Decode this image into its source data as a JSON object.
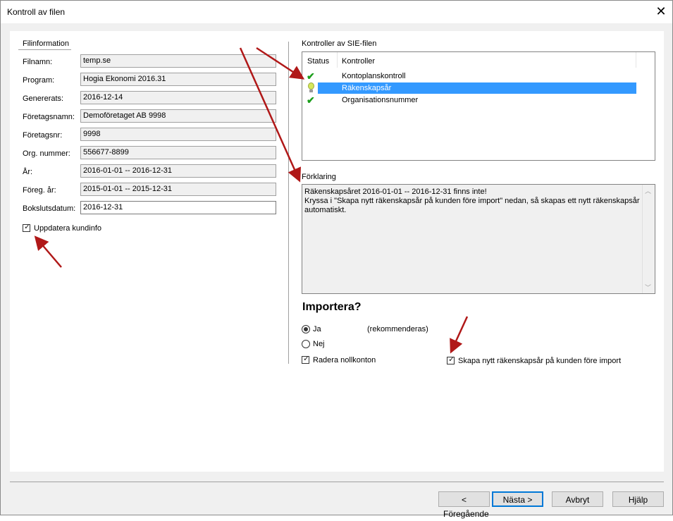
{
  "window": {
    "title": "Kontroll av filen",
    "close_glyph": "✕"
  },
  "fileinfo": {
    "group_label": "Filinformation",
    "fields": [
      {
        "label": "Filnamn:",
        "value": "temp.se"
      },
      {
        "label": "Program:",
        "value": "Hogia Ekonomi 2016.31"
      },
      {
        "label": "Genererats:",
        "value": "2016-12-14"
      },
      {
        "label": "Företagsnamn:",
        "value": "Demoföretaget AB 9998"
      },
      {
        "label": "Företagsnr:",
        "value": "9998"
      },
      {
        "label": "Org. nummer:",
        "value": "556677-8899"
      },
      {
        "label": "År:",
        "value": "2016-01-01 -- 2016-12-31"
      },
      {
        "label": "Föreg. år:",
        "value": "2015-01-01 -- 2015-12-31"
      },
      {
        "label": "Bokslutsdatum:",
        "value": "2016-12-31"
      }
    ],
    "update_checkbox": {
      "label": "Uppdatera kundinfo",
      "checked": true
    }
  },
  "checks": {
    "group_label": "Kontroller av SIE-filen",
    "columns": [
      "Status",
      "Kontroller"
    ],
    "rows": [
      {
        "status": "check-icon",
        "name": "Kontoplanskontroll"
      },
      {
        "status": "lightbulb-icon",
        "name": "Räkenskapsår",
        "selected": true
      },
      {
        "status": "check-icon",
        "name": "Organisationsnummer"
      }
    ]
  },
  "explanation": {
    "label": "Förklaring",
    "text": "Räkenskapsåret 2016-01-01 -- 2016-12-31 finns inte!\nKryssa i \"Skapa nytt räkenskapsår på kunden före import\" nedan, så skapas ett nytt räkenskapsår automatiskt."
  },
  "import": {
    "heading": "Importera?",
    "options": [
      {
        "label": "Ja",
        "note": "(rekommenderas)",
        "selected": true
      },
      {
        "label": "Nej",
        "selected": false
      }
    ],
    "delete_zero_accounts": {
      "label": "Radera nollkonton",
      "checked": true
    },
    "create_fiscal_year": {
      "label": "Skapa nytt räkenskapsår på kunden före import",
      "checked": true
    }
  },
  "buttons": {
    "previous": "< Föregående",
    "next": "Nästa >",
    "cancel": "Avbryt",
    "help": "Hjälp"
  },
  "colors": {
    "selection": "#3399ff",
    "annotation_arrow": "#b01818",
    "check": "#1b9e1b"
  }
}
